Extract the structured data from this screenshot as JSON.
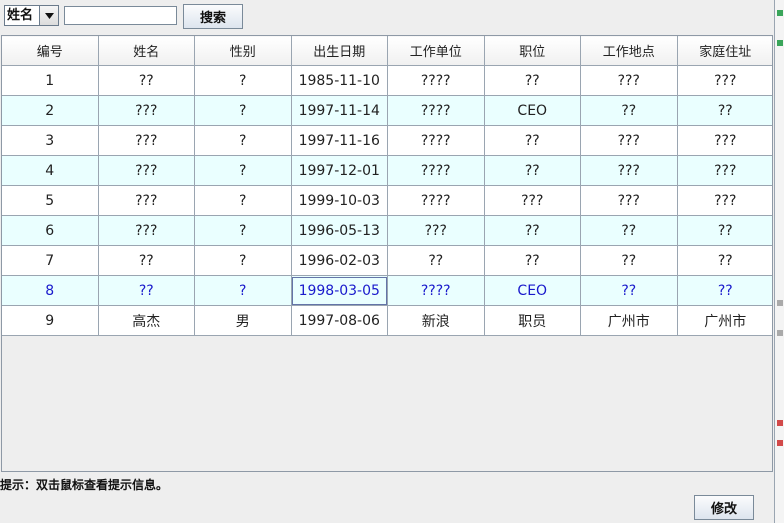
{
  "toolbar": {
    "field_select": {
      "selected": "姓名"
    },
    "search_input": {
      "value": "",
      "placeholder": ""
    },
    "search_button": "搜索"
  },
  "table": {
    "headers": [
      "编号",
      "姓名",
      "性别",
      "出生日期",
      "工作单位",
      "职位",
      "工作地点",
      "家庭住址"
    ],
    "rows": [
      [
        "1",
        "??",
        "?",
        "1985-11-10",
        "????",
        "??",
        "???",
        "???"
      ],
      [
        "2",
        "???",
        "?",
        "1997-11-14",
        "????",
        "CEO",
        "??",
        "??"
      ],
      [
        "3",
        "???",
        "?",
        "1997-11-16",
        "????",
        "??",
        "???",
        "???"
      ],
      [
        "4",
        "???",
        "?",
        "1997-12-01",
        "????",
        "??",
        "???",
        "???"
      ],
      [
        "5",
        "???",
        "?",
        "1999-10-03",
        "????",
        "???",
        "???",
        "???"
      ],
      [
        "6",
        "???",
        "?",
        "1996-05-13",
        "???",
        "??",
        "??",
        "??"
      ],
      [
        "7",
        "??",
        "?",
        "1996-02-03",
        "??",
        "??",
        "??",
        "??"
      ],
      [
        "8",
        "??",
        "?",
        "1998-03-05",
        "????",
        "CEO",
        "??",
        "??"
      ],
      [
        "9",
        "高杰",
        "男",
        "1997-08-06",
        "新浪",
        "职员",
        "广州市",
        "广州市"
      ]
    ],
    "selected_row": 8
  },
  "hint": "提示：双击鼠标查看提示信息。",
  "modify_button": "修改",
  "colors": {
    "alt_row": "#eaffff",
    "selected_text": "#1a1acc",
    "background": "#eeeeee"
  }
}
